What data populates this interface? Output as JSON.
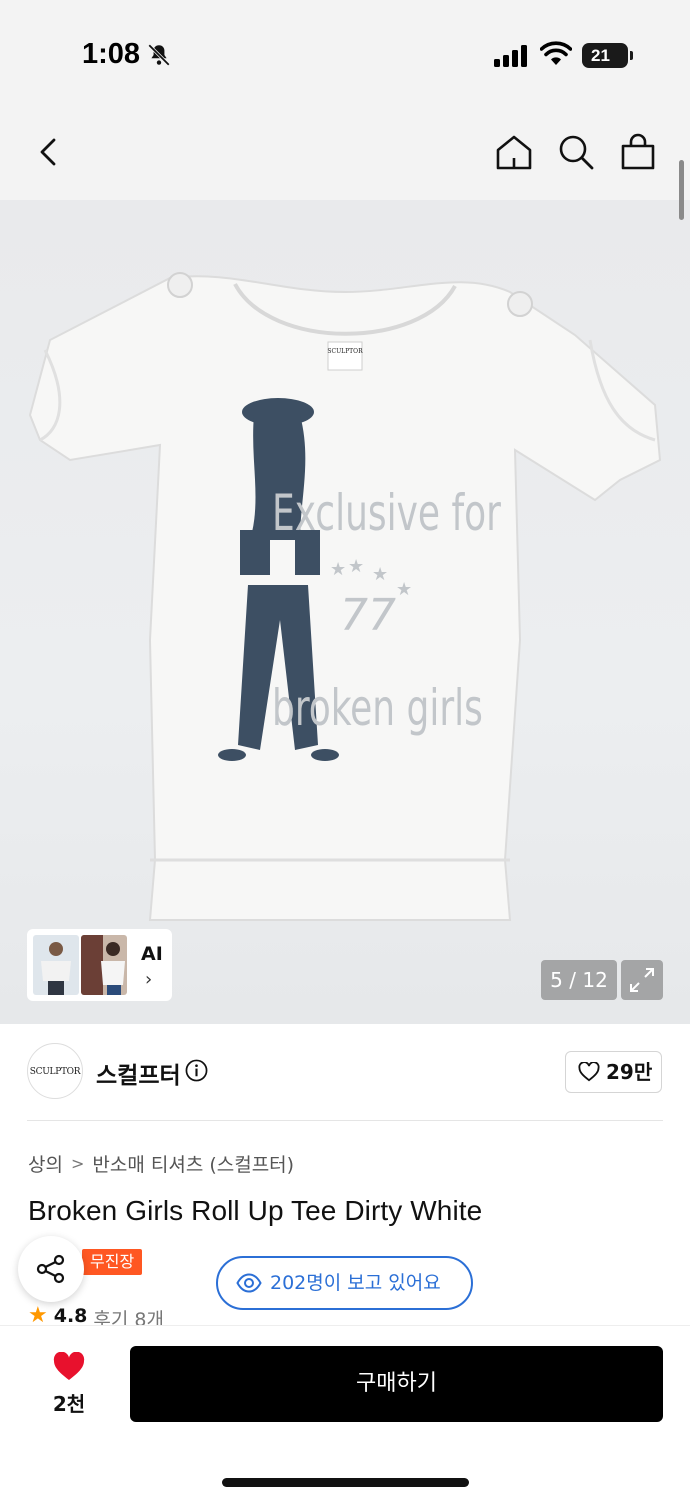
{
  "status_bar": {
    "time": "1:08",
    "battery": "21"
  },
  "nav": {
    "icons": [
      "back-icon",
      "home-icon",
      "search-icon",
      "bag-icon"
    ]
  },
  "gallery": {
    "counter": "5 / 12",
    "ai_label": "AI",
    "ai_chevron": "›",
    "shirt_print": [
      "Exclusive for",
      "77",
      "broken girls"
    ],
    "shirt_tag": "SCULPTOR"
  },
  "brand": {
    "logo_text": "SCULPTOR",
    "name": "스컬프터",
    "likes": "29만"
  },
  "product": {
    "breadcrumb": [
      "상의",
      "반소매 티셔츠 (스컬프터)"
    ],
    "breadcrumb_sep": ">",
    "title": "Broken Girls Roll Up Tee Dirty White",
    "badge": "무진장",
    "viewers": "202명이 보고 있어요",
    "rating": "4.8",
    "reviews": "후기 8개"
  },
  "bottom_bar": {
    "wish_count": "2천",
    "buy_label": "구매하기"
  },
  "colors": {
    "accent_blue": "#2b6fd6",
    "badge_orange": "#ff5722",
    "heart_red": "#e8112d",
    "star": "#ff9800"
  }
}
